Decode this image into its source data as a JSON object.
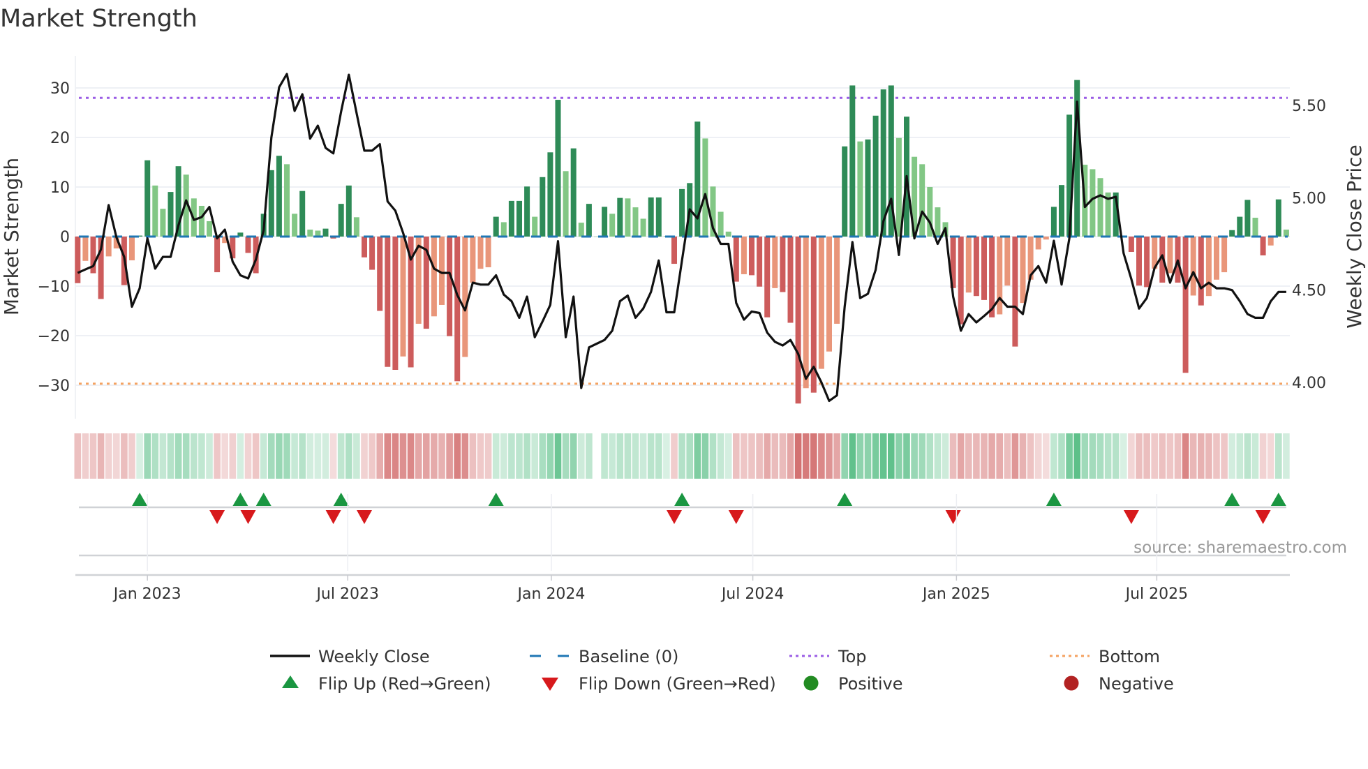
{
  "title": "Market Strength",
  "source": "source: sharemaestro.com",
  "colors": {
    "green_strong": "#2e8b57",
    "green_light": "#82c785",
    "red_strong": "#cd5c5c",
    "red_light": "#e9967a",
    "close_line": "#111111",
    "baseline": "#1f77b4",
    "top": "#9b5de5",
    "bottom": "#f4a261",
    "flip_up": "#1a9641",
    "flip_down": "#d7191c",
    "positive": "#228b22",
    "negative": "#b22222",
    "strip_green": "#3cb371",
    "strip_red": "#cd5c5c"
  },
  "legend": [
    {
      "key": "close",
      "label": "Weekly Close"
    },
    {
      "key": "baseline",
      "label": "Baseline (0)"
    },
    {
      "key": "top",
      "label": "Top"
    },
    {
      "key": "bottom",
      "label": "Bottom"
    },
    {
      "key": "flip_up",
      "label": "Flip Up (Red→Green)"
    },
    {
      "key": "flip_down",
      "label": "Flip Down (Green→Red)"
    },
    {
      "key": "positive",
      "label": "Positive"
    },
    {
      "key": "negative",
      "label": "Negative"
    }
  ],
  "chart_data": {
    "type": "bar+line",
    "title": "Market Strength",
    "ylabel": "Market Strength",
    "ylabel_right": "Weekly Close Price",
    "start_week": "2022-10-30",
    "frequency": "weekly",
    "ylim": [
      -37,
      37
    ],
    "ylim_right_ref": [
      4.0,
      5.5
    ],
    "y_left_ticks": [
      "−30",
      "−20",
      "−10",
      "0",
      "10",
      "20",
      "30"
    ],
    "y_left_tick_values": [
      -30,
      -20,
      -10,
      0,
      10,
      20,
      30
    ],
    "y_right_ticks": [
      "4.00",
      "4.50",
      "5.00",
      "5.50"
    ],
    "y_right_tick_values": [
      4.0,
      4.5,
      5.0,
      5.5
    ],
    "x_ticks": [
      "Jan 2023",
      "Jul 2023",
      "Jan 2024",
      "Jul 2024",
      "Jan 2025",
      "Jul 2025"
    ],
    "x_tick_dates": [
      "2023-01-01",
      "2023-07-01",
      "2024-01-01",
      "2024-07-01",
      "2025-01-01",
      "2025-07-01"
    ],
    "top_level": 28,
    "bottom_level": -29.7,
    "baseline": 0,
    "strength": [
      -9.4,
      -4.9,
      -7.4,
      -12.6,
      -4.0,
      -2.4,
      -9.8,
      -4.8,
      0.2,
      15.4,
      10.3,
      5.6,
      9.0,
      14.2,
      12.5,
      7.7,
      6.2,
      3.1,
      -7.2,
      -1.3,
      -4.4,
      0.8,
      -3.3,
      -7.4,
      4.6,
      13.4,
      16.3,
      14.6,
      4.6,
      9.2,
      1.4,
      1.2,
      1.6,
      -0.4,
      6.6,
      10.3,
      3.9,
      -4.2,
      -6.7,
      -15.0,
      -26.3,
      -26.9,
      -24.2,
      -26.4,
      -17.6,
      -18.6,
      -16.1,
      -13.8,
      -20.1,
      -29.2,
      -24.3,
      -9.3,
      -6.5,
      -6.2,
      4.0,
      2.9,
      7.2,
      7.2,
      10.1,
      4.0,
      12.0,
      17.0,
      27.6,
      13.2,
      17.8,
      2.8,
      6.6,
      0,
      6.0,
      4.6,
      7.8,
      7.7,
      5.9,
      3.6,
      7.9,
      7.9,
      0.1,
      -5.5,
      9.6,
      10.8,
      23.2,
      19.8,
      10.1,
      5.0,
      1.0,
      -9.1,
      -7.6,
      -7.8,
      -10.1,
      -16.3,
      -10.4,
      -11.2,
      -17.4,
      -33.7,
      -30.6,
      -31.5,
      -26.7,
      -23.2,
      -17.6,
      18.2,
      30.5,
      19.2,
      19.6,
      24.4,
      29.7,
      30.5,
      19.9,
      24.2,
      16.1,
      14.6,
      10.0,
      5.9,
      2.9,
      -10.4,
      -17.7,
      -11.3,
      -12.0,
      -12.8,
      -16.3,
      -15.7,
      -9.9,
      -22.2,
      -13.4,
      -8.7,
      -2.6,
      -0.6,
      6.0,
      10.4,
      24.6,
      31.6,
      14.5,
      13.6,
      11.8,
      8.9,
      8.9,
      0.2,
      -3.1,
      -9.9,
      -10.2,
      -6.5,
      -9.3,
      -7.4,
      -9.3,
      -27.5,
      -11.9,
      -13.9,
      -12.0,
      -8.7,
      -7.2,
      1.3,
      4.0,
      7.4,
      3.8,
      -3.8,
      -1.8,
      7.5,
      1.4
    ],
    "weekly_close": [
      4.593,
      4.612,
      4.63,
      4.72,
      4.96,
      4.786,
      4.68,
      4.41,
      4.51,
      4.78,
      4.616,
      4.68,
      4.68,
      4.85,
      4.986,
      4.88,
      4.895,
      4.95,
      4.78,
      4.827,
      4.654,
      4.58,
      4.563,
      4.665,
      4.823,
      5.326,
      5.598,
      5.67,
      5.47,
      5.56,
      5.32,
      5.39,
      5.27,
      5.24,
      5.466,
      5.666,
      5.458,
      5.255,
      5.255,
      5.29,
      4.98,
      4.93,
      4.81,
      4.665,
      4.74,
      4.718,
      4.616,
      4.593,
      4.593,
      4.473,
      4.39,
      4.54,
      4.53,
      4.53,
      4.58,
      4.476,
      4.44,
      4.35,
      4.465,
      4.245,
      4.33,
      4.42,
      4.765,
      4.245,
      4.465,
      3.97,
      4.19,
      4.21,
      4.23,
      4.28,
      4.44,
      4.47,
      4.35,
      4.4,
      4.49,
      4.66,
      4.38,
      4.38,
      4.66,
      4.937,
      4.888,
      5.02,
      4.835,
      4.75,
      4.75,
      4.43,
      4.34,
      4.384,
      4.376,
      4.27,
      4.22,
      4.2,
      4.23,
      4.155,
      4.02,
      4.085,
      4.0,
      3.9,
      3.93,
      4.41,
      4.76,
      4.457,
      4.48,
      4.61,
      4.873,
      4.994,
      4.69,
      5.117,
      4.78,
      4.925,
      4.866,
      4.75,
      4.836,
      4.465,
      4.28,
      4.37,
      4.325,
      4.36,
      4.397,
      4.457,
      4.41,
      4.41,
      4.37,
      4.58,
      4.63,
      4.54,
      4.767,
      4.53,
      4.78,
      5.52,
      4.95,
      4.994,
      5.013,
      4.994,
      5.005,
      4.7,
      4.56,
      4.4,
      4.457,
      4.62,
      4.688,
      4.54,
      4.66,
      4.51,
      4.597,
      4.51,
      4.54,
      4.51,
      4.51,
      4.5,
      4.44,
      4.37,
      4.35,
      4.35,
      4.44,
      4.49,
      4.49
    ],
    "grid": true,
    "legend_position": "bottom"
  }
}
